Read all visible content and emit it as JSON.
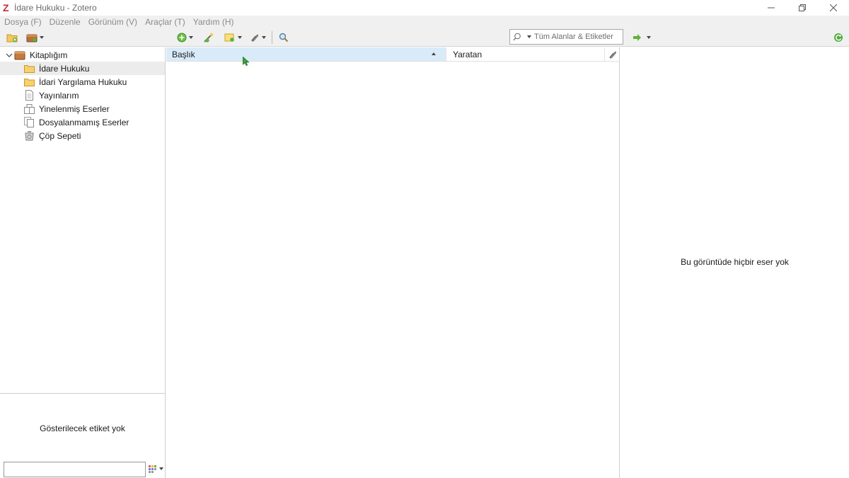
{
  "window": {
    "title": "İdare Hukuku - Zotero",
    "logo_letter": "Z"
  },
  "menubar": {
    "items": [
      "Dosya (F)",
      "Düzenle",
      "Görünüm (V)",
      "Araçlar (T)",
      "Yardım (H)"
    ]
  },
  "toolbar": {
    "search_placeholder": "Tüm Alanlar & Etiketler"
  },
  "collections": {
    "library": "Kitaplığım",
    "items": [
      {
        "label": "İdare Hukuku",
        "icon": "folder-icon",
        "selected": true
      },
      {
        "label": "İdari Yargılama Hukuku",
        "icon": "folder-icon",
        "selected": false
      },
      {
        "label": "Yayınlarım",
        "icon": "document-icon",
        "selected": false
      },
      {
        "label": "Yinelenmiş Eserler",
        "icon": "duplicate-icon",
        "selected": false
      },
      {
        "label": "Dosyalanmamış Eserler",
        "icon": "unfiled-icon",
        "selected": false
      },
      {
        "label": "Çöp Sepeti",
        "icon": "trash-icon",
        "selected": false
      }
    ]
  },
  "tags": {
    "empty_message": "Gösterilecek etiket yok"
  },
  "items_table": {
    "columns": {
      "title": "Başlık",
      "creator": "Yaratan"
    },
    "rows": []
  },
  "item_pane": {
    "empty_message": "Bu görüntüde hiçbir eser yok"
  },
  "colors": {
    "accent_header": "#d9ebf9",
    "zotero_red": "#cc2936",
    "menu_text": "#8a8a8a"
  }
}
